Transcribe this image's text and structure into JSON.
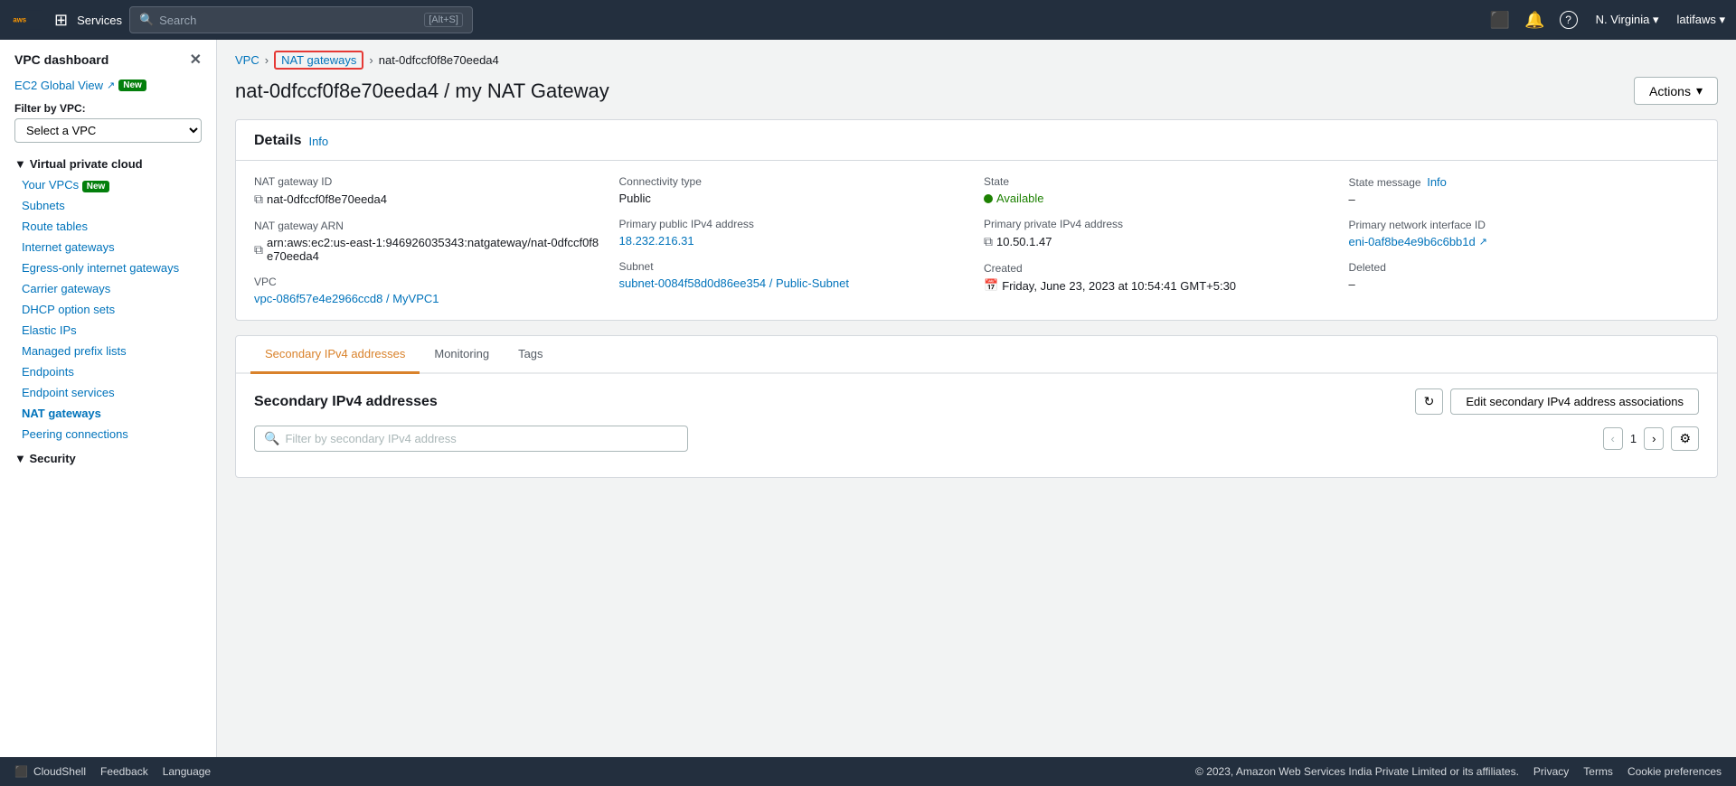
{
  "topnav": {
    "search_placeholder": "Search",
    "search_shortcut": "[Alt+S]",
    "services_label": "Services",
    "region": "N. Virginia",
    "user": "latifaws",
    "grid_icon": "⊞",
    "bell_icon": "🔔",
    "help_icon": "?",
    "terminal_icon": "⬛"
  },
  "sidebar": {
    "title": "VPC dashboard",
    "ec2_global_view": "EC2 Global View",
    "new_badge": "New",
    "filter_label": "Filter by VPC:",
    "filter_placeholder": "Select a VPC",
    "section_vpc": "Virtual private cloud",
    "items": [
      {
        "label": "Your VPCs",
        "badge": "New",
        "active": false
      },
      {
        "label": "Subnets",
        "active": false
      },
      {
        "label": "Route tables",
        "active": false
      },
      {
        "label": "Internet gateways",
        "active": false
      },
      {
        "label": "Egress-only internet gateways",
        "active": false
      },
      {
        "label": "Carrier gateways",
        "active": false
      },
      {
        "label": "DHCP option sets",
        "active": false
      },
      {
        "label": "Elastic IPs",
        "active": false
      },
      {
        "label": "Managed prefix lists",
        "active": false
      },
      {
        "label": "Endpoints",
        "active": false
      },
      {
        "label": "Endpoint services",
        "active": false
      },
      {
        "label": "NAT gateways",
        "active": true
      },
      {
        "label": "Peering connections",
        "active": false
      }
    ],
    "security_section": "Security"
  },
  "breadcrumb": {
    "vpc": "VPC",
    "nat_gateways": "NAT gateways",
    "current": "nat-0dfccf0f8e70eeda4"
  },
  "page": {
    "title": "nat-0dfccf0f8e70eeda4 / my NAT Gateway",
    "actions_label": "Actions"
  },
  "details": {
    "card_title": "Details",
    "info_label": "Info",
    "fields": {
      "nat_gateway_id_label": "NAT gateway ID",
      "nat_gateway_id_value": "nat-0dfccf0f8e70eeda4",
      "nat_gateway_arn_label": "NAT gateway ARN",
      "nat_gateway_arn_value": "arn:aws:ec2:us-east-1:946926035343:natgateway/nat-0dfccf0f8e70eeda4",
      "vpc_label": "VPC",
      "vpc_value": "vpc-086f57e4e2966ccd8 / MyVPC1",
      "connectivity_type_label": "Connectivity type",
      "connectivity_type_value": "Public",
      "primary_public_ipv4_label": "Primary public IPv4 address",
      "primary_public_ipv4_value": "18.232.216.31",
      "subnet_label": "Subnet",
      "subnet_value": "subnet-0084f58d0d86ee354 / Public-Subnet",
      "state_label": "State",
      "state_value": "Available",
      "primary_private_ipv4_label": "Primary private IPv4 address",
      "primary_private_ipv4_value": "10.50.1.47",
      "created_label": "Created",
      "created_value": "Friday, June 23, 2023 at 10:54:41 GMT+5:30",
      "state_message_label": "State message",
      "state_message_info": "Info",
      "state_message_value": "–",
      "primary_network_interface_label": "Primary network interface ID",
      "primary_network_interface_value": "eni-0af8be4e9b6c6bb1d",
      "deleted_label": "Deleted",
      "deleted_value": "–"
    }
  },
  "tabs": {
    "items": [
      {
        "label": "Secondary IPv4 addresses",
        "active": true
      },
      {
        "label": "Monitoring",
        "active": false
      },
      {
        "label": "Tags",
        "active": false
      }
    ]
  },
  "secondary_ipv4": {
    "section_title": "Secondary IPv4 addresses",
    "refresh_tooltip": "Refresh",
    "edit_button": "Edit secondary IPv4 address associations",
    "filter_placeholder": "Filter by secondary IPv4 address",
    "pagination": {
      "page": "1",
      "prev_disabled": true,
      "next_disabled": false
    }
  },
  "bottom_bar": {
    "cloudshell_label": "CloudShell",
    "feedback_label": "Feedback",
    "language_label": "Language",
    "copyright": "© 2023, Amazon Web Services India Private Limited or its affiliates.",
    "privacy": "Privacy",
    "terms": "Terms",
    "cookie_prefs": "Cookie preferences"
  }
}
